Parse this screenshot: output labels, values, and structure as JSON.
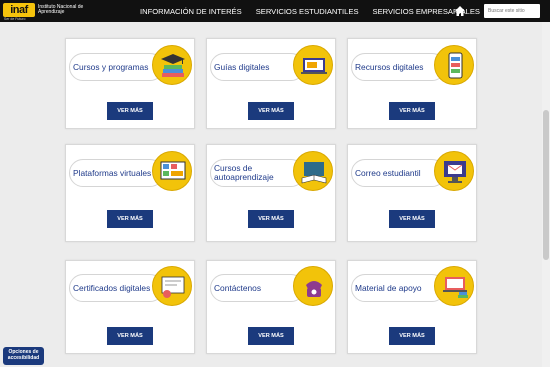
{
  "header": {
    "logo_mark": "inaf",
    "logo_sub": "Ser de Futuro",
    "logo_text": "Instituto Nacional de Aprendizaje",
    "nav": [
      "INFORMACIÓN DE INTERÉS",
      "SERVICIOS ESTUDIANTILES",
      "SERVICIOS EMPRESARIALES"
    ],
    "search_placeholder": "Buscar este sitio"
  },
  "cards": [
    {
      "label": "Cursos y programas",
      "button": "VER MÁS",
      "icon": "graduation-books-icon"
    },
    {
      "label": "Guías digitales",
      "button": "VER MÁS",
      "icon": "laptop-folder-icon"
    },
    {
      "label": "Recursos digitales",
      "button": "VER MÁS",
      "icon": "mobile-phone-icon"
    },
    {
      "label": "Plataformas virtuales",
      "button": "VER MÁS",
      "icon": "learning-board-icon"
    },
    {
      "label": "Cursos de autoaprendizaje",
      "button": "VER MÁS",
      "icon": "open-book-icon"
    },
    {
      "label": "Correo estudiantil",
      "button": "VER MÁS",
      "icon": "email-monitor-icon"
    },
    {
      "label": "Certificados digitales",
      "button": "VER MÁS",
      "icon": "certificate-icon"
    },
    {
      "label": "Contáctenos",
      "button": "VER MÁS",
      "icon": "telephone-icon"
    },
    {
      "label": "Material de apoyo",
      "button": "VER MÁS",
      "icon": "laptop-books-icon"
    }
  ],
  "accessibility": "Opciones de accesibilidad",
  "colors": {
    "accent": "#1b3a7d",
    "icon_bg": "#f2c30a",
    "header_bg": "#111111"
  }
}
